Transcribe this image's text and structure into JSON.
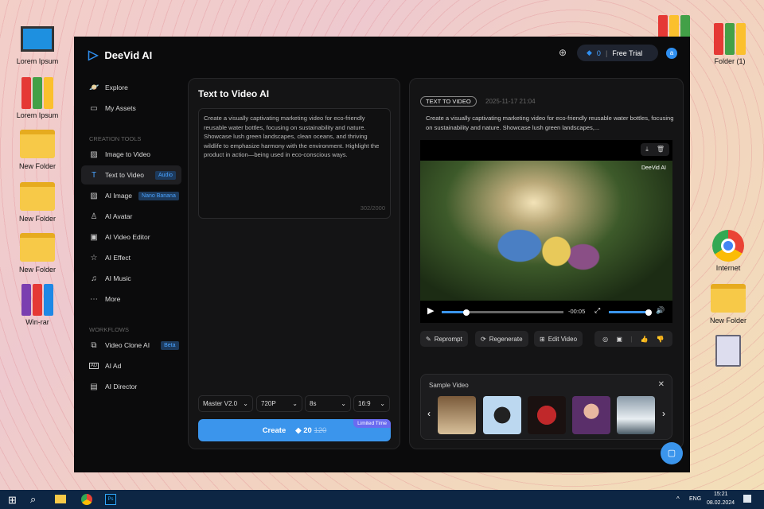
{
  "desktop": {
    "icons": [
      "Lorem Ipsum",
      "Lorem Ipsum",
      "New Folder",
      "New Folder",
      "New Folder",
      "Win-rar",
      "Folder (1)",
      "Internet",
      "New Folder"
    ]
  },
  "app": {
    "name": "DeeVid AI",
    "credits": "0",
    "plan": "Free Trial",
    "avatar": "a"
  },
  "sidebar": {
    "items": [
      "Explore",
      "My Assets"
    ],
    "creation_title": "CREATION TOOLS",
    "creation": [
      {
        "label": "Image to Video"
      },
      {
        "label": "Text to Video",
        "badge": "Audio"
      },
      {
        "label": "AI Image",
        "badge": "Nano Banana"
      },
      {
        "label": "AI Avatar"
      },
      {
        "label": "AI Video Editor"
      },
      {
        "label": "AI Effect"
      },
      {
        "label": "AI Music"
      },
      {
        "label": "More"
      }
    ],
    "workflows_title": "WORKFLOWS",
    "workflows": [
      {
        "label": "Video Clone AI",
        "badge": "Beta"
      },
      {
        "label": "AI Ad"
      },
      {
        "label": "AI Director"
      }
    ]
  },
  "editor": {
    "title": "Text to Video AI",
    "prompt": "Create a visually captivating marketing video for eco-friendly reusable water bottles, focusing on sustainability and nature. Showcase lush green landscapes, clean oceans, and thriving wildlife to emphasize harmony with the environment. Highlight the product in action—being used in eco-conscious ways.",
    "count": "302/2000",
    "model": "Master V2.0",
    "resolution": "720P",
    "duration": "8s",
    "ratio": "16:9",
    "create": "Create",
    "cost": "20",
    "old_cost": "120",
    "promo": "Limited Time"
  },
  "result": {
    "tag": "TEXT TO VIDEO",
    "date": "2025-11-17 21:04",
    "prompt": "Create a visually captivating marketing video for eco-friendly reusable water bottles, focusing on sustainability and nature. Showcase lush green landscapes,...",
    "watermark": "DeeVid AI",
    "time_left": "-00:05",
    "progress": 0.2,
    "volume": 1.0,
    "actions": [
      "Reprompt",
      "Regenerate",
      "Edit Video"
    ]
  },
  "samples": {
    "title": "Sample Video"
  },
  "taskbar": {
    "lang": "ENG",
    "time": "15:21",
    "date": "08.02.2024"
  }
}
